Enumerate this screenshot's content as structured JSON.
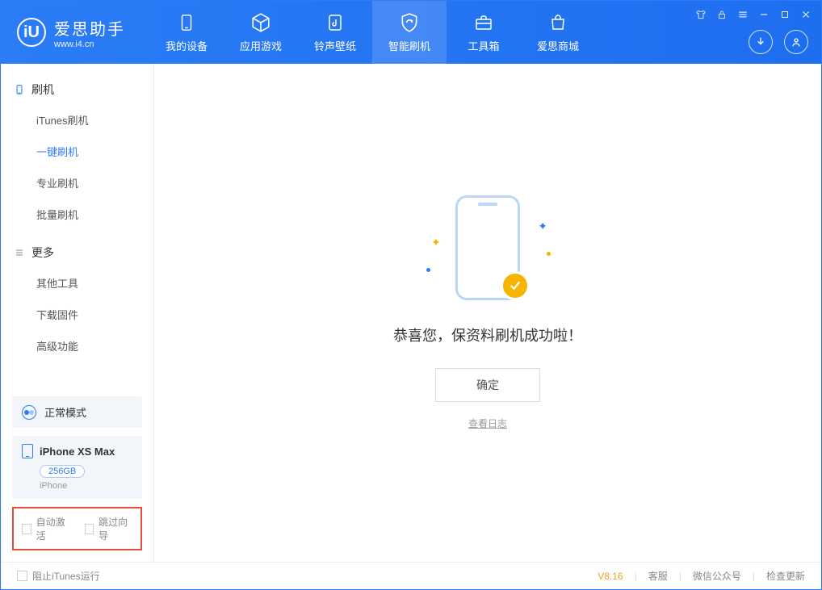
{
  "app": {
    "title": "爱思助手",
    "url": "www.i4.cn"
  },
  "tabs": {
    "device": "我的设备",
    "apps": "应用游戏",
    "ring": "铃声壁纸",
    "flash": "智能刷机",
    "toolbox": "工具箱",
    "store": "爱思商城"
  },
  "sidebar": {
    "group_flash": "刷机",
    "items_flash": {
      "itunes": "iTunes刷机",
      "onekey": "一键刷机",
      "pro": "专业刷机",
      "batch": "批量刷机"
    },
    "group_more": "更多",
    "items_more": {
      "other": "其他工具",
      "firmware": "下载固件",
      "advanced": "高级功能"
    }
  },
  "mode": {
    "label": "正常模式"
  },
  "device": {
    "name": "iPhone XS Max",
    "storage": "256GB",
    "type": "iPhone"
  },
  "checkboxes": {
    "auto_activate": "自动激活",
    "skip_guide": "跳过向导"
  },
  "main": {
    "success_msg": "恭喜您，保资料刷机成功啦！",
    "confirm": "确定",
    "view_log": "查看日志"
  },
  "footer": {
    "block_itunes": "阻止iTunes运行",
    "version": "V8.16",
    "support": "客服",
    "wechat": "微信公众号",
    "check_update": "检查更新"
  }
}
